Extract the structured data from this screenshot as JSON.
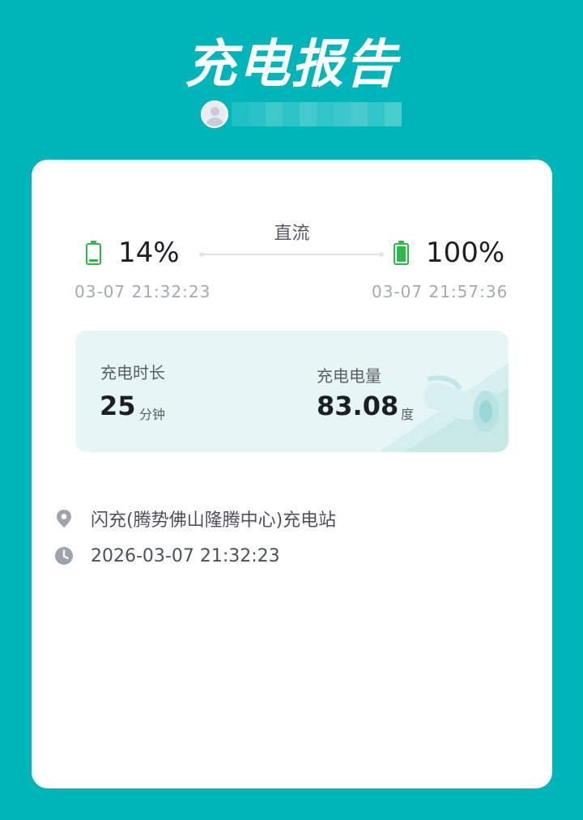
{
  "header": {
    "title": "充电报告"
  },
  "user": {
    "avatar_icon": "default-avatar-icon",
    "name_obscured": true
  },
  "charge": {
    "mode": "直流",
    "start": {
      "percent": "14%",
      "level": 0.14,
      "time": "03-07 21:32:23",
      "icon": "battery-low-icon"
    },
    "end": {
      "percent": "100%",
      "level": 1.0,
      "time": "03-07 21:57:36",
      "icon": "battery-full-icon"
    }
  },
  "stats": {
    "duration": {
      "label": "充电时长",
      "value": "25",
      "unit": "分钟"
    },
    "energy": {
      "label": "充电电量",
      "value": "83.08",
      "unit": "度"
    }
  },
  "info": {
    "station": {
      "icon": "location-pin-icon",
      "text": "闪充(腾势佛山隆腾中心)充电站"
    },
    "datetime": {
      "icon": "clock-icon",
      "text": "2026-03-07 21:32:23"
    }
  },
  "colors": {
    "background": "#00b5ba",
    "battery_green": "#2db84a",
    "stats_bg": "#e6f6f5",
    "text_dark": "#1d1f24",
    "text_muted": "#a5a9b2"
  }
}
